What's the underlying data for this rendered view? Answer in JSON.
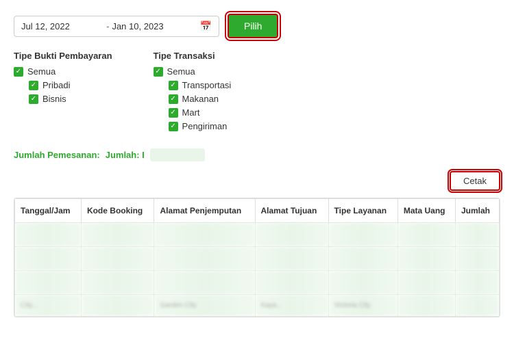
{
  "dateRange": {
    "start": "Jul 12, 2022",
    "separator": "-",
    "end": "Jan 10, 2023",
    "calendarIcon": "📅"
  },
  "pilihButton": {
    "label": "Pilih"
  },
  "cetakButton": {
    "label": "Cetak"
  },
  "filters": {
    "bukti": {
      "title": "Tipe Bukti Pembayaran",
      "items": [
        {
          "label": "Semua",
          "checked": true,
          "sub": false
        },
        {
          "label": "Pribadi",
          "checked": true,
          "sub": true
        },
        {
          "label": "Bisnis",
          "checked": true,
          "sub": true
        }
      ]
    },
    "transaksi": {
      "title": "Tipe Transaksi",
      "items": [
        {
          "label": "Semua",
          "checked": true,
          "sub": false
        },
        {
          "label": "Transportasi",
          "checked": true,
          "sub": true
        },
        {
          "label": "Makanan",
          "checked": true,
          "sub": true
        },
        {
          "label": "Mart",
          "checked": true,
          "sub": true
        },
        {
          "label": "Pengiriman",
          "checked": true,
          "sub": true
        }
      ]
    }
  },
  "summary": {
    "jumlahPemesananLabel": "Jumlah Pemesanan:",
    "jumlahLabel": "Jumlah: I",
    "jumlahValue": ""
  },
  "table": {
    "headers": [
      "Tanggal/Jam",
      "Kode Booking",
      "Alamat Penjemputan",
      "Alamat Tujuan",
      "Tipe Layanan",
      "Mata Uang",
      "Jumlah"
    ],
    "blurRows": 3,
    "lastRowCells": [
      "City...",
      "Garden City",
      "Kaya...",
      "Victoria City",
      ""
    ]
  }
}
